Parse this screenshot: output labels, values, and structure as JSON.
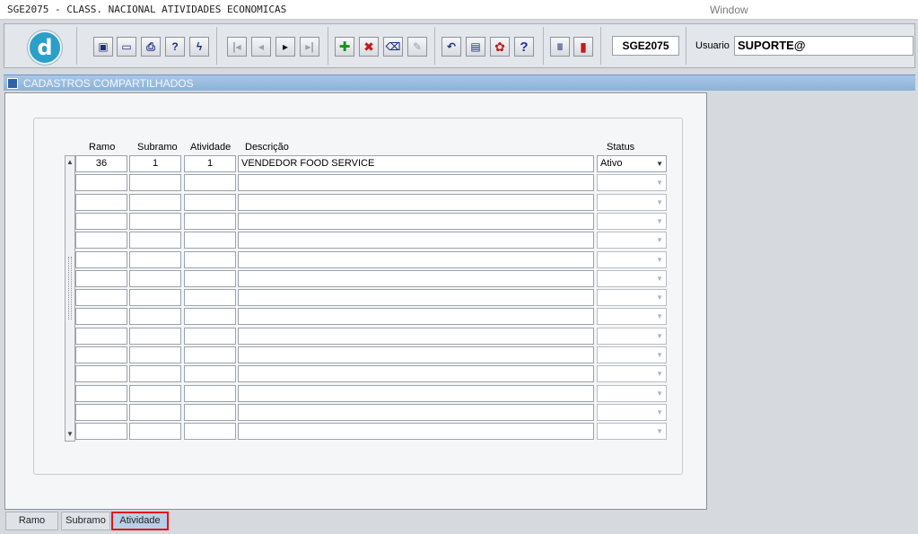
{
  "window": {
    "title": "SGE2075 - CLASS. NACIONAL ATIVIDADES ECONOMICAS",
    "menu_label": "Window"
  },
  "toolbar": {
    "logo_letter": "d",
    "form_name": "SGE2075",
    "user_label": "Usuario",
    "user_value": "SUPORTE@"
  },
  "section": {
    "title": "CADASTROS COMPARTILHADOS"
  },
  "grid": {
    "columns": {
      "ramo": "Ramo",
      "subramo": "Subramo",
      "atividade": "Atividade",
      "descricao": "Descrição",
      "status": "Status"
    },
    "rows": [
      {
        "ramo": "36",
        "subramo": "1",
        "atividade": "1",
        "descricao": "VENDEDOR FOOD SERVICE",
        "status": "Ativo"
      },
      {
        "ramo": "",
        "subramo": "",
        "atividade": "",
        "descricao": "",
        "status": ""
      },
      {
        "ramo": "",
        "subramo": "",
        "atividade": "",
        "descricao": "",
        "status": ""
      },
      {
        "ramo": "",
        "subramo": "",
        "atividade": "",
        "descricao": "",
        "status": ""
      },
      {
        "ramo": "",
        "subramo": "",
        "atividade": "",
        "descricao": "",
        "status": ""
      },
      {
        "ramo": "",
        "subramo": "",
        "atividade": "",
        "descricao": "",
        "status": ""
      },
      {
        "ramo": "",
        "subramo": "",
        "atividade": "",
        "descricao": "",
        "status": ""
      },
      {
        "ramo": "",
        "subramo": "",
        "atividade": "",
        "descricao": "",
        "status": ""
      },
      {
        "ramo": "",
        "subramo": "",
        "atividade": "",
        "descricao": "",
        "status": ""
      },
      {
        "ramo": "",
        "subramo": "",
        "atividade": "",
        "descricao": "",
        "status": ""
      },
      {
        "ramo": "",
        "subramo": "",
        "atividade": "",
        "descricao": "",
        "status": ""
      },
      {
        "ramo": "",
        "subramo": "",
        "atividade": "",
        "descricao": "",
        "status": ""
      },
      {
        "ramo": "",
        "subramo": "",
        "atividade": "",
        "descricao": "",
        "status": ""
      },
      {
        "ramo": "",
        "subramo": "",
        "atividade": "",
        "descricao": "",
        "status": ""
      },
      {
        "ramo": "",
        "subramo": "",
        "atividade": "",
        "descricao": "",
        "status": ""
      }
    ]
  },
  "tabs": [
    {
      "label": "Ramo",
      "selected": false
    },
    {
      "label": "Subramo",
      "selected": false
    },
    {
      "label": "Atividade",
      "selected": true
    }
  ],
  "colors": {
    "selected_tab_border": "#e0161a",
    "section_bar": "#8bb1d8",
    "logo": "#2a9fc9"
  }
}
